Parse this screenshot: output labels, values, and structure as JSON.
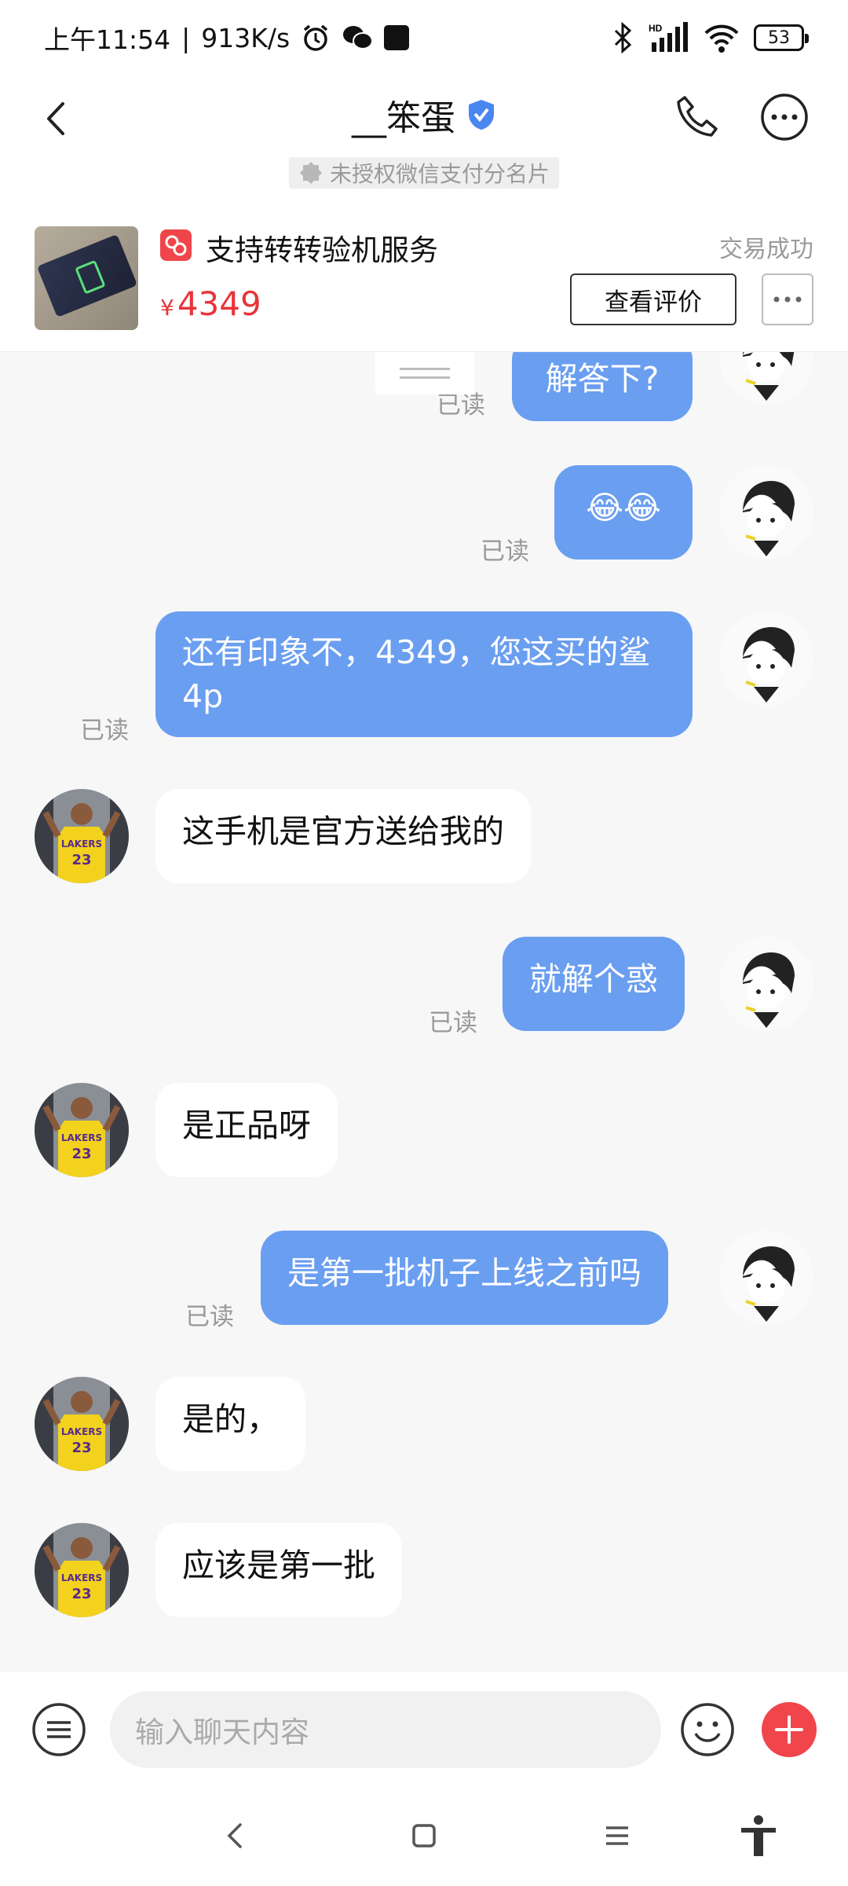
{
  "status_bar": {
    "time": "上午11:54",
    "speed": "913K/s",
    "battery": "53"
  },
  "header": {
    "title": "__笨蛋"
  },
  "auth_notice": "未授权微信支付分名片",
  "product": {
    "name": "支持转转验机服务",
    "status": "交易成功",
    "currency": "¥",
    "price": "4349",
    "review_button": "查看评价"
  },
  "messages": [
    {
      "from": "me",
      "text": "解答下?",
      "read": "已读"
    },
    {
      "from": "me",
      "text": "😂😂",
      "read": "已读"
    },
    {
      "from": "me",
      "line1": "还有印象不，4349，您这买的鲨",
      "line2": "4p",
      "read": "已读"
    },
    {
      "from": "them",
      "text": "这手机是官方送给我的"
    },
    {
      "from": "me",
      "text": "就解个惑",
      "read": "已读"
    },
    {
      "from": "them",
      "text": "是正品呀"
    },
    {
      "from": "me",
      "text": "是第一批机子上线之前吗",
      "read": "已读"
    },
    {
      "from": "them",
      "text": "是的，"
    },
    {
      "from": "them",
      "text": "应该是第一批"
    }
  ],
  "input": {
    "placeholder": "输入聊天内容"
  },
  "colors": {
    "my_bubble": "#6a9ef0",
    "accent_red": "#f0454a",
    "price_red": "#e8343b"
  }
}
